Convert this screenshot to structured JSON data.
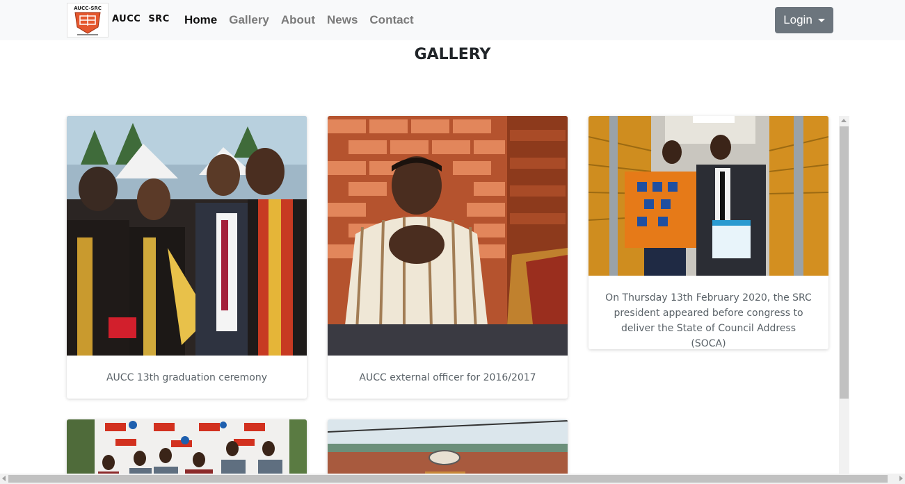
{
  "brand": {
    "logo_text": "AUCC-SRC",
    "name": "AUCC SRC"
  },
  "nav": {
    "items": [
      {
        "label": "Home",
        "active": true
      },
      {
        "label": "Gallery",
        "active": false
      },
      {
        "label": "About",
        "active": false
      },
      {
        "label": "News",
        "active": false
      },
      {
        "label": "Contact",
        "active": false
      }
    ]
  },
  "login": {
    "label": "Login"
  },
  "page": {
    "title": "GALLERY"
  },
  "gallery": [
    {
      "caption": "AUCC 13th graduation ceremony",
      "photo": "graduation-group-photo"
    },
    {
      "caption": "AUCC external officer for 2016/2017",
      "photo": "portrait-brick-wall-photo"
    },
    {
      "caption": "On Thursday 13th February 2020, the SRC president appeared before congress to deliver the State of Council Address (SOCA)",
      "photo": "hallway-two-men-photo"
    },
    {
      "caption": "",
      "photo": "event-banner-group-photo"
    },
    {
      "caption": "",
      "photo": "building-roof-photo"
    }
  ],
  "colors": {
    "navbar_bg": "#f8f9fa",
    "login_bg": "#6c757d",
    "logo_orange": "#e4572e"
  }
}
